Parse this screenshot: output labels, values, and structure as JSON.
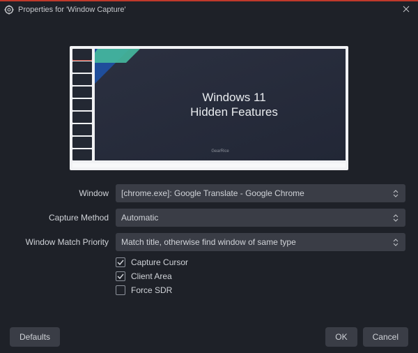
{
  "titlebar": {
    "title": "Properties for 'Window Capture'"
  },
  "preview": {
    "slide_line1": "Windows 11",
    "slide_line2": "Hidden Features",
    "slide_footer": "GearRice"
  },
  "form": {
    "window": {
      "label": "Window",
      "value": "[chrome.exe]: Google Translate - Google Chrome"
    },
    "capture_method": {
      "label": "Capture Method",
      "value": "Automatic"
    },
    "match_priority": {
      "label": "Window Match Priority",
      "value": "Match title, otherwise find window of same type"
    },
    "capture_cursor": {
      "label": "Capture Cursor",
      "checked": true
    },
    "client_area": {
      "label": "Client Area",
      "checked": true
    },
    "force_sdr": {
      "label": "Force SDR",
      "checked": false
    }
  },
  "buttons": {
    "defaults": "Defaults",
    "ok": "OK",
    "cancel": "Cancel"
  }
}
